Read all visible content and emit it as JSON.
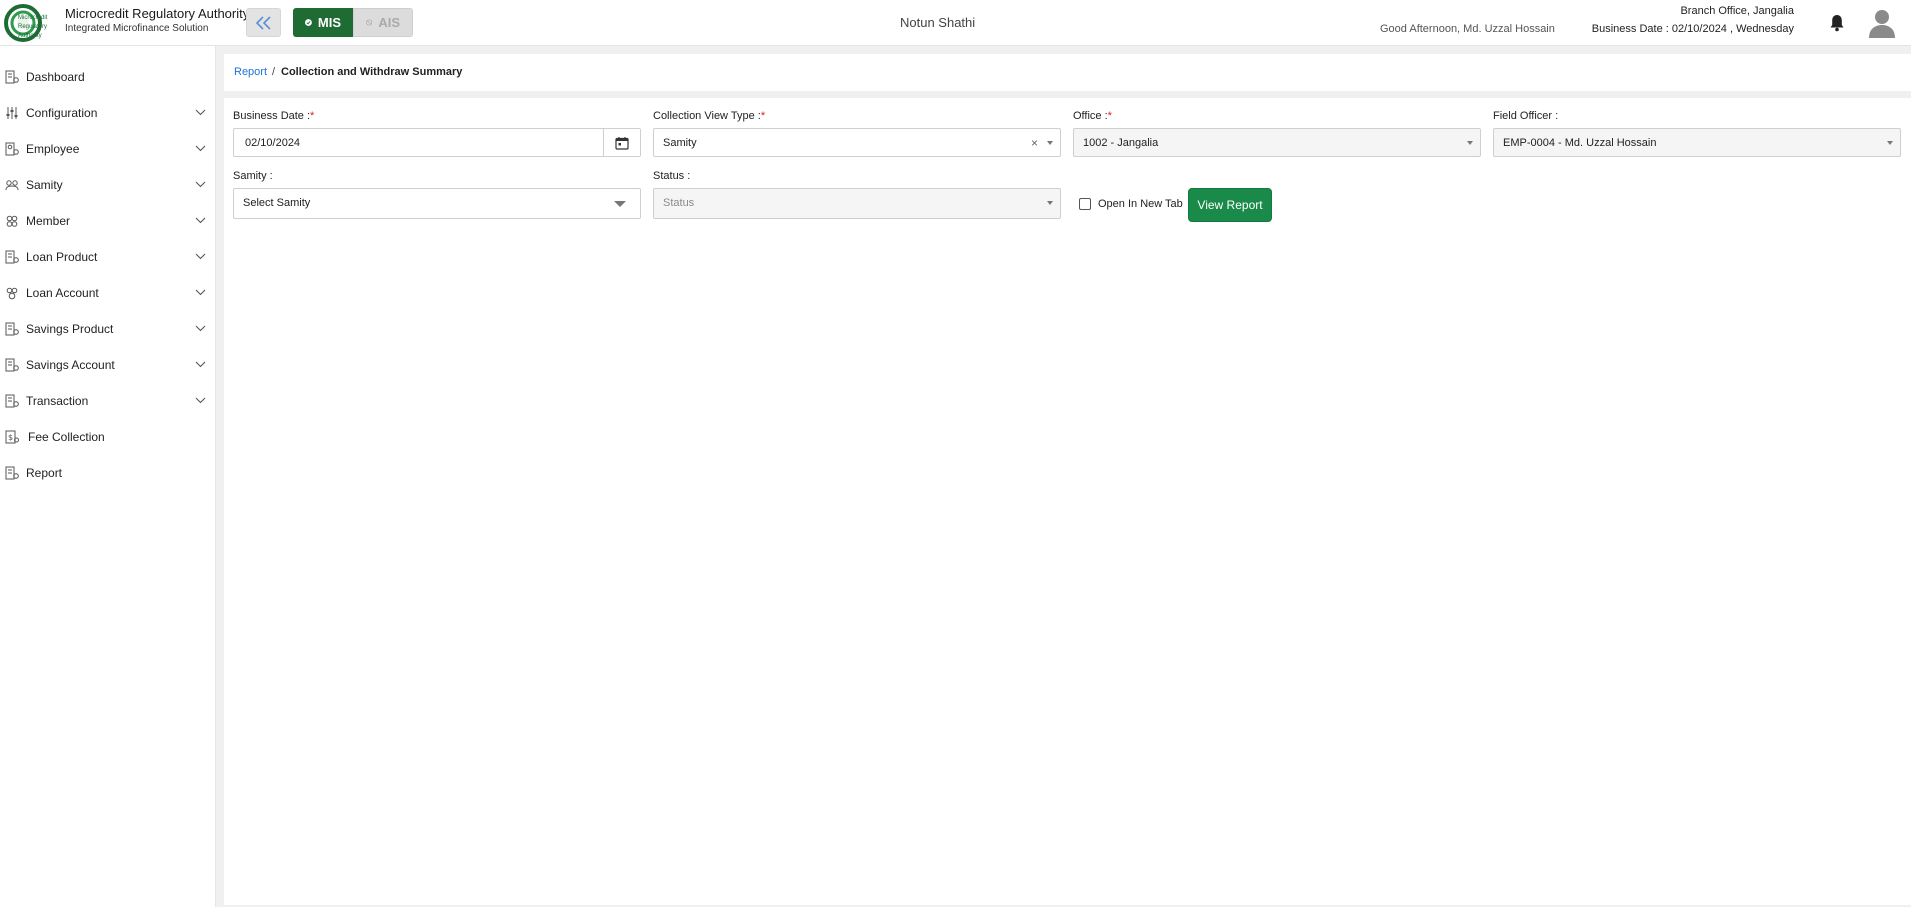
{
  "header": {
    "brand_title": "Microcredit Regulatory Authority",
    "brand_subtitle": "Integrated Microfinance Solution",
    "logo_text_lines": [
      "Microcredit",
      "Regulatory",
      "Authority"
    ],
    "mode_mis": "MIS",
    "mode_ais": "AIS",
    "app_name": "Notun Shathi",
    "greeting": "Good Afternoon, Md. Uzzal Hossain",
    "branch": "Branch Office, Jangalia",
    "business_date": "Business Date : 02/10/2024 , Wednesday",
    "colors": {
      "brand_green": "#1e6b34",
      "accent_blue": "#1e73d6"
    },
    "icons": [
      "double-chevron-left-icon",
      "check-circle-icon",
      "ban-icon",
      "bell-icon",
      "user-avatar-icon"
    ]
  },
  "sidebar": {
    "items": [
      {
        "label": "Dashboard",
        "icon": "dashboard-icon",
        "expandable": false
      },
      {
        "label": "Configuration",
        "icon": "sliders-icon",
        "expandable": true
      },
      {
        "label": "Employee",
        "icon": "employee-icon",
        "expandable": true
      },
      {
        "label": "Samity",
        "icon": "group-icon",
        "expandable": true
      },
      {
        "label": "Member",
        "icon": "member-icon",
        "expandable": true
      },
      {
        "label": "Loan Product",
        "icon": "product-icon",
        "expandable": true
      },
      {
        "label": "Loan Account",
        "icon": "account-icon",
        "expandable": true
      },
      {
        "label": "Savings Product",
        "icon": "product-icon",
        "expandable": true
      },
      {
        "label": "Savings Account",
        "icon": "product-icon",
        "expandable": true
      },
      {
        "label": "Transaction",
        "icon": "transaction-icon",
        "expandable": true
      },
      {
        "label": "Fee Collection",
        "icon": "fee-icon",
        "expandable": false
      },
      {
        "label": "Report",
        "icon": "report-icon",
        "expandable": false
      }
    ]
  },
  "breadcrumb": {
    "parent": "Report",
    "separator": "/",
    "current": "Collection and Withdraw Summary"
  },
  "form": {
    "business_date": {
      "label": "Business Date :",
      "required": "*",
      "value": "02/10/2024"
    },
    "collection_view_type": {
      "label": "Collection View Type :",
      "required": "*",
      "value": "Samity",
      "clear": "×"
    },
    "office": {
      "label": "Office :",
      "required": "*",
      "value": "1002 - Jangalia"
    },
    "field_officer": {
      "label": "Field Officer :",
      "value": "EMP-0004 - Md. Uzzal Hossain"
    },
    "samity": {
      "label": "Samity :",
      "placeholder": "Select Samity"
    },
    "status": {
      "label": "Status :",
      "placeholder": "Status"
    },
    "open_new_tab": {
      "label": "Open In New Tab",
      "checked": false
    },
    "view_report_label": "View Report",
    "colors": {
      "button_green": "#1a8a4a",
      "required_red": "#d62020"
    }
  }
}
